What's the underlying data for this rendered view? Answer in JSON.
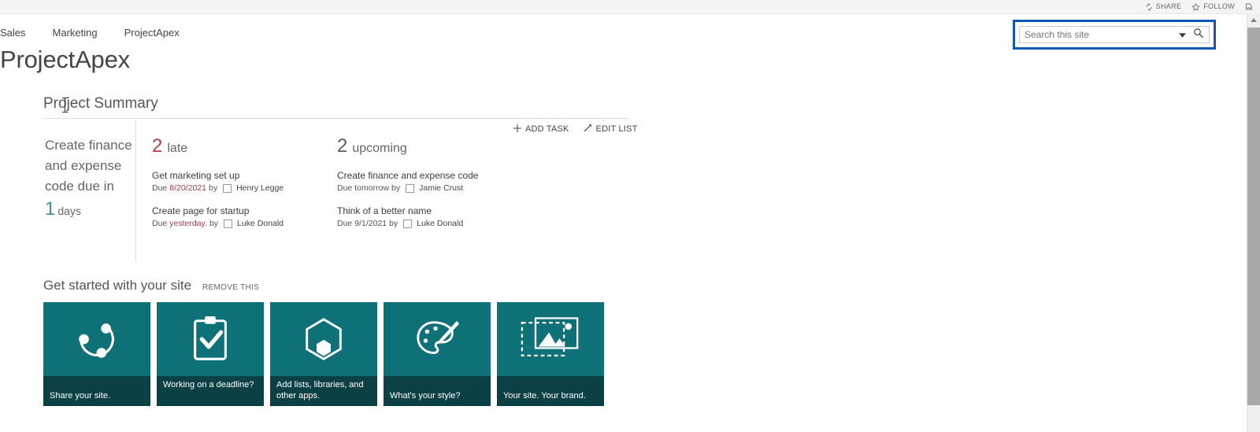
{
  "suite": {
    "share_label": "SHARE",
    "follow_label": "FOLLOW",
    "share_icon": "share-icon",
    "follow_icon": "star-icon",
    "sync_icon": "save-sync-icon"
  },
  "search": {
    "placeholder": "Search this site",
    "value": "",
    "dropdown_icon": "chevron-down-icon",
    "go_icon": "search-icon",
    "focus_color": "#1157b8"
  },
  "nav": {
    "items": [
      {
        "label": "Sales"
      },
      {
        "label": "Marketing"
      },
      {
        "label": "ProjectApex"
      }
    ]
  },
  "page": {
    "title": "ProjectApex"
  },
  "project_summary": {
    "title": "Project Summary",
    "actions": [
      {
        "label": "ADD TASK",
        "icon": "plus-icon"
      },
      {
        "label": "EDIT LIST",
        "icon": "pencil-icon"
      }
    ],
    "countdown": {
      "task_text": "Create finance and expense code due in",
      "number": "1",
      "unit": "days",
      "number_color": "#4a8b8e"
    },
    "groups": [
      {
        "count": "2",
        "label": "late",
        "count_color": "#b03c46",
        "tasks": [
          {
            "name": "Get marketing set up",
            "due_prefix": "Due",
            "due_value": "8/20/2021",
            "due_highlight": true,
            "by_label": "by",
            "person": "Henry Legge"
          },
          {
            "name": "Create page for startup",
            "due_prefix": "Due",
            "due_value": "yesterday.",
            "due_highlight": true,
            "by_label": "by",
            "person": "Luke Donald"
          }
        ]
      },
      {
        "count": "2",
        "label": "upcoming",
        "count_color": "#5c5c5c",
        "tasks": [
          {
            "name": "Create finance and expense code",
            "due_prefix": "Due",
            "due_value": "tomorrow",
            "due_highlight": false,
            "by_label": "by",
            "person": "Jamie Crust"
          },
          {
            "name": "Think of a better name",
            "due_prefix": "Due",
            "due_value": "9/1/2021",
            "due_highlight": false,
            "by_label": "by",
            "person": "Luke Donald"
          }
        ]
      }
    ]
  },
  "get_started": {
    "title": "Get started with your site",
    "remove_label": "REMOVE THIS",
    "tile_color": "#0f7178",
    "tile_foot_color": "#0b4045",
    "tiles": [
      {
        "label": "Share your site.",
        "icon": "share-network-icon"
      },
      {
        "label": "Working on a deadline?",
        "icon": "clipboard-check-icon"
      },
      {
        "label": "Add lists, libraries, and other apps.",
        "icon": "hexagon-app-icon"
      },
      {
        "label": "What's your style?",
        "icon": "palette-brush-icon"
      },
      {
        "label": "Your site. Your brand.",
        "icon": "image-frame-icon"
      }
    ]
  },
  "scrollbar": {
    "up_icon": "scroll-up-arrow-icon",
    "down_icon": "scroll-down-arrow-icon"
  }
}
